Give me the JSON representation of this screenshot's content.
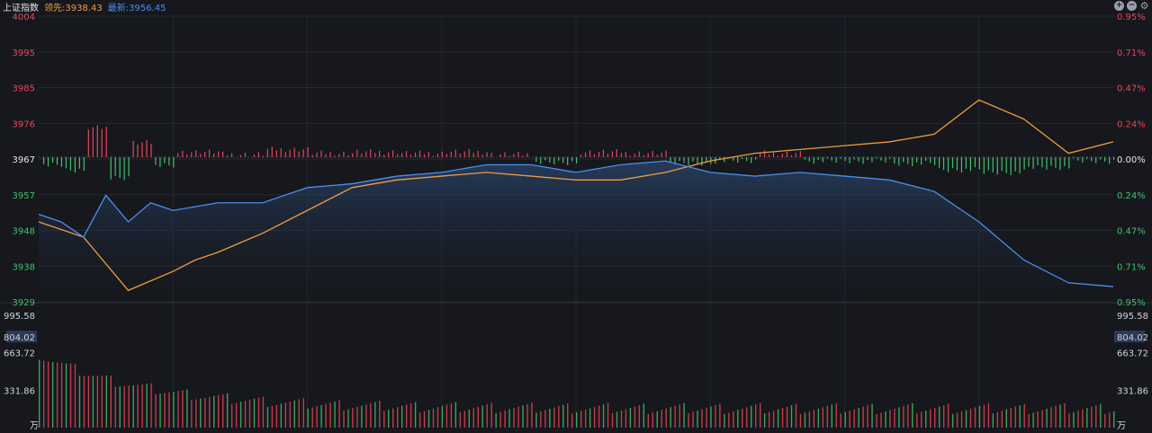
{
  "header": {
    "title": "上证指数",
    "lead_label": "领先:3938.43",
    "last_label": "最新:3956.45",
    "colors": {
      "lead": "#f29a3f",
      "last": "#4a8ef0"
    }
  },
  "chart_data": {
    "type": "line",
    "prev_close": 3967,
    "ylim": [
      3929,
      4004
    ],
    "y_ticks_left": [
      "4004",
      "3995",
      "3985",
      "3976",
      "3967",
      "3957",
      "3948",
      "3938",
      "3929"
    ],
    "y_ticks_right": [
      "0.95%",
      "0.71%",
      "0.47%",
      "0.24%",
      "0.00%",
      "0.24%",
      "0.47%",
      "0.71%",
      "0.95%"
    ],
    "series": [
      {
        "name": "领先",
        "color": "#f29a3f",
        "x": [
          0,
          10,
          20,
          30,
          35,
          40,
          50,
          60,
          70,
          80,
          90,
          100,
          110,
          120,
          130,
          140,
          150,
          160,
          170,
          180,
          190,
          200,
          210,
          220,
          230,
          240
        ],
        "y": [
          3950,
          3946,
          3932,
          3937,
          3940,
          3942,
          3947,
          3953,
          3959,
          3961,
          3962,
          3963,
          3962,
          3961,
          3961,
          3963,
          3966,
          3968,
          3969,
          3970,
          3971,
          3973,
          3982,
          3977,
          3968,
          3971
        ]
      },
      {
        "name": "最新",
        "color": "#4a8ef0",
        "x": [
          0,
          5,
          10,
          15,
          20,
          25,
          30,
          40,
          50,
          60,
          70,
          80,
          90,
          100,
          110,
          120,
          130,
          140,
          150,
          160,
          170,
          180,
          190,
          200,
          210,
          220,
          230,
          240
        ],
        "y": [
          3952,
          3950,
          3946,
          3957,
          3950,
          3955,
          3953,
          3955,
          3955,
          3959,
          3960,
          3962,
          3963,
          3965,
          3965,
          3963,
          3965,
          3966,
          3963,
          3962,
          3963,
          3962,
          3961,
          3958,
          3950,
          3940,
          3934,
          3933
        ]
      }
    ],
    "bars_zero_axis": "prev_close",
    "volume": {
      "unit": "万",
      "y_ticks": [
        "995.58",
        "804.02",
        "663.72",
        "331.86"
      ],
      "highlight": "804.02"
    },
    "grid": true
  }
}
